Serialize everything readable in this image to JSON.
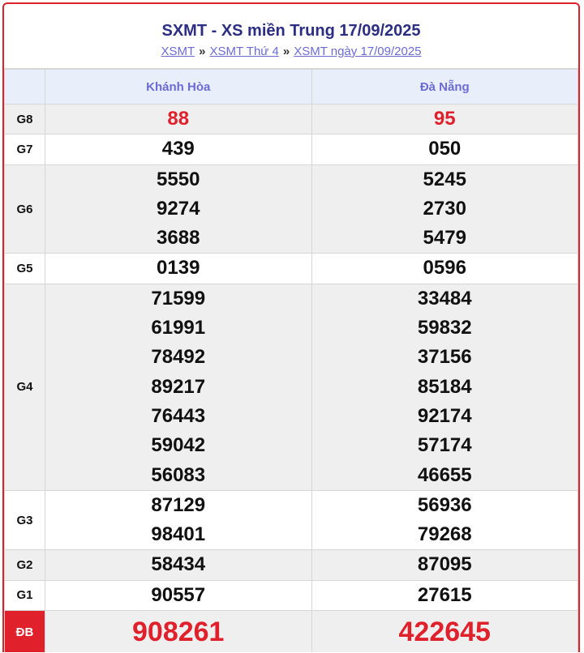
{
  "header": {
    "title": "SXMT - XS miền Trung 17/09/2025",
    "breadcrumb": [
      {
        "label": "XSMT"
      },
      {
        "label": "XSMT Thứ 4"
      },
      {
        "label": "XSMT ngày 17/09/2025"
      }
    ],
    "separator": "»"
  },
  "table": {
    "columns": [
      "Khánh Hòa",
      "Đà Nẵng"
    ],
    "rows": [
      {
        "label": "G8",
        "khanh_hoa": [
          "88"
        ],
        "da_nang": [
          "95"
        ]
      },
      {
        "label": "G7",
        "khanh_hoa": [
          "439"
        ],
        "da_nang": [
          "050"
        ]
      },
      {
        "label": "G6",
        "khanh_hoa": [
          "5550",
          "9274",
          "3688"
        ],
        "da_nang": [
          "5245",
          "2730",
          "5479"
        ]
      },
      {
        "label": "G5",
        "khanh_hoa": [
          "0139"
        ],
        "da_nang": [
          "0596"
        ]
      },
      {
        "label": "G4",
        "khanh_hoa": [
          "71599",
          "61991",
          "78492",
          "89217",
          "76443",
          "59042",
          "56083"
        ],
        "da_nang": [
          "33484",
          "59832",
          "37156",
          "85184",
          "92174",
          "57174",
          "46655"
        ]
      },
      {
        "label": "G3",
        "khanh_hoa": [
          "87129",
          "98401"
        ],
        "da_nang": [
          "56936",
          "79268"
        ]
      },
      {
        "label": "G2",
        "khanh_hoa": [
          "58434"
        ],
        "da_nang": [
          "87095"
        ]
      },
      {
        "label": "G1",
        "khanh_hoa": [
          "90557"
        ],
        "da_nang": [
          "27615"
        ]
      },
      {
        "label": "ĐB",
        "khanh_hoa": [
          "908261"
        ],
        "da_nang": [
          "422645"
        ]
      }
    ]
  },
  "colors": {
    "accent_red": "#e0212b",
    "title_blue": "#2b2e83",
    "link_blue": "#6b6bd6",
    "header_bg": "#e9eefb"
  }
}
